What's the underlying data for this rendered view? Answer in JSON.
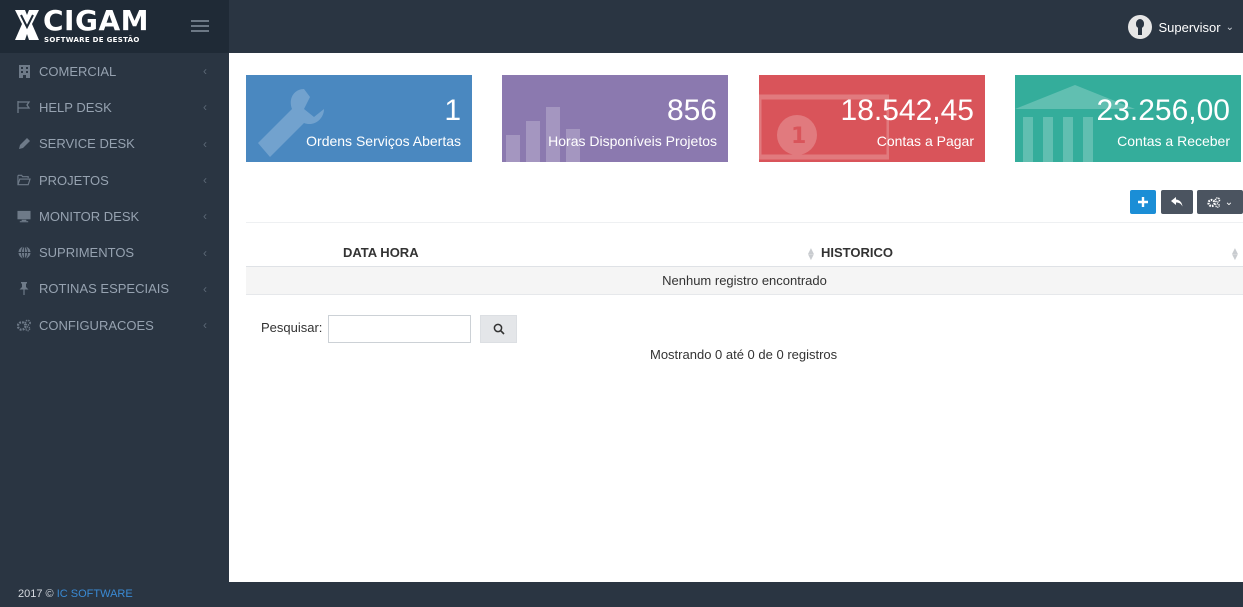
{
  "brand": {
    "name": "CIGAM",
    "tagline": "SOFTWARE DE GESTÃO"
  },
  "user": {
    "name": "Supervisor",
    "icon": "user-avatar-icon"
  },
  "sidebar": {
    "items": [
      {
        "label": "COMERCIAL",
        "icon": "building-icon"
      },
      {
        "label": "HELP DESK",
        "icon": "flag-icon"
      },
      {
        "label": "SERVICE DESK",
        "icon": "pencil-icon"
      },
      {
        "label": "PROJETOS",
        "icon": "folder-open-icon"
      },
      {
        "label": "MONITOR DESK",
        "icon": "monitor-icon"
      },
      {
        "label": "SUPRIMENTOS",
        "icon": "globe-icon"
      },
      {
        "label": "ROTINAS ESPECIAIS",
        "icon": "thumbtack-icon"
      },
      {
        "label": "CONFIGURACOES",
        "icon": "cogs-icon"
      }
    ]
  },
  "tiles": [
    {
      "value": "1",
      "label": "Ordens Serviços Abertas",
      "color": "#4a88c0",
      "icon": "wrench-icon"
    },
    {
      "value": "856",
      "label": "Horas Disponíveis Projetos",
      "color": "#8b79af",
      "icon": "bar-chart-icon"
    },
    {
      "value": "18.542,45",
      "label": "Contas a Pagar",
      "color": "#d9545a",
      "icon": "money-icon"
    },
    {
      "value": "23.256,00",
      "label": "Contas a Receber",
      "color": "#34ad9b",
      "icon": "bank-icon"
    }
  ],
  "toolbar": {
    "add_icon": "plus-icon",
    "back_icon": "reply-icon",
    "tools_icon": "cogs-icon"
  },
  "table": {
    "columns": [
      "DATA HORA",
      "HISTORICO"
    ],
    "empty_message": "Nenhum registro encontrado"
  },
  "search": {
    "label": "Pesquisar:",
    "value": "",
    "placeholder": ""
  },
  "info": "Mostrando 0 até 0 de 0 registros",
  "footer": {
    "year": "2017 ©",
    "company": "IC SOFTWARE"
  }
}
